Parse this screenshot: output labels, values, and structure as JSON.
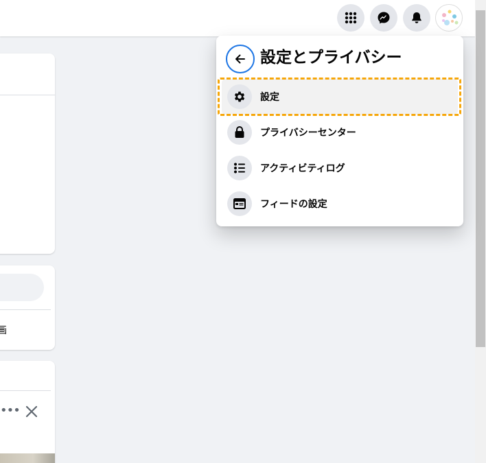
{
  "topbar": {
    "buttons": [
      {
        "name": "menu-grid",
        "icon": "grid-icon"
      },
      {
        "name": "messenger",
        "icon": "messenger-icon"
      },
      {
        "name": "notifications",
        "icon": "bell-icon"
      }
    ],
    "avatar_icon": "profile-avatar"
  },
  "background": {
    "partial_text": "画"
  },
  "settings_menu": {
    "title": "設定とプライバシー",
    "back_icon": "arrow-left-icon",
    "items": [
      {
        "label": "設定",
        "icon": "gear-icon",
        "selected": true
      },
      {
        "label": "プライバシーセンター",
        "icon": "lock-icon",
        "selected": false
      },
      {
        "label": "アクティビティログ",
        "icon": "list-icon",
        "selected": false
      },
      {
        "label": "フィードの設定",
        "icon": "feed-window-icon",
        "selected": false
      }
    ]
  },
  "colors": {
    "focus_ring": "#f6a609",
    "back_ring": "#1b74e4",
    "icon_bg": "#e4e6eb",
    "page_bg": "#f0f2f5"
  }
}
